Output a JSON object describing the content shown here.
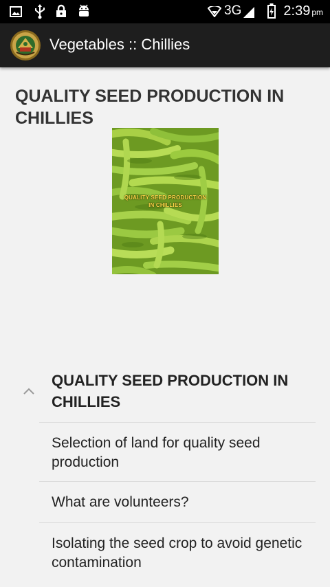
{
  "status_bar": {
    "icons_left": [
      "image-icon",
      "usb-icon",
      "lock-icon",
      "android-icon"
    ],
    "network": "3G",
    "time": "2:39",
    "ampm": "pm"
  },
  "app_bar": {
    "title": "Vegetables :: Chillies",
    "logo_icon": "university-emblem-icon"
  },
  "main": {
    "heading": "QUALITY SEED PRODUCTION IN CHILLIES",
    "cover_image": {
      "caption": "QUALITY SEED PRODUCTION IN CHILLIES",
      "caption_line1": "QUALITY SEED PRODUCTION",
      "caption_line2": "IN CHILLIES"
    }
  },
  "toc": {
    "title": "QUALITY SEED PRODUCTION IN CHILLIES",
    "expanded_icon": "chevron-up-icon",
    "items": [
      {
        "label": "Selection of land for quality seed production"
      },
      {
        "label": "What are volunteers?"
      },
      {
        "label": "Isolating the seed crop to avoid genetic contamination"
      }
    ]
  },
  "colors": {
    "status_bar_bg": "#000000",
    "app_bar_bg": "#1e1e1e",
    "page_bg": "#f2f2f2",
    "text": "#222222",
    "cover_caption": "#ffd84a"
  }
}
